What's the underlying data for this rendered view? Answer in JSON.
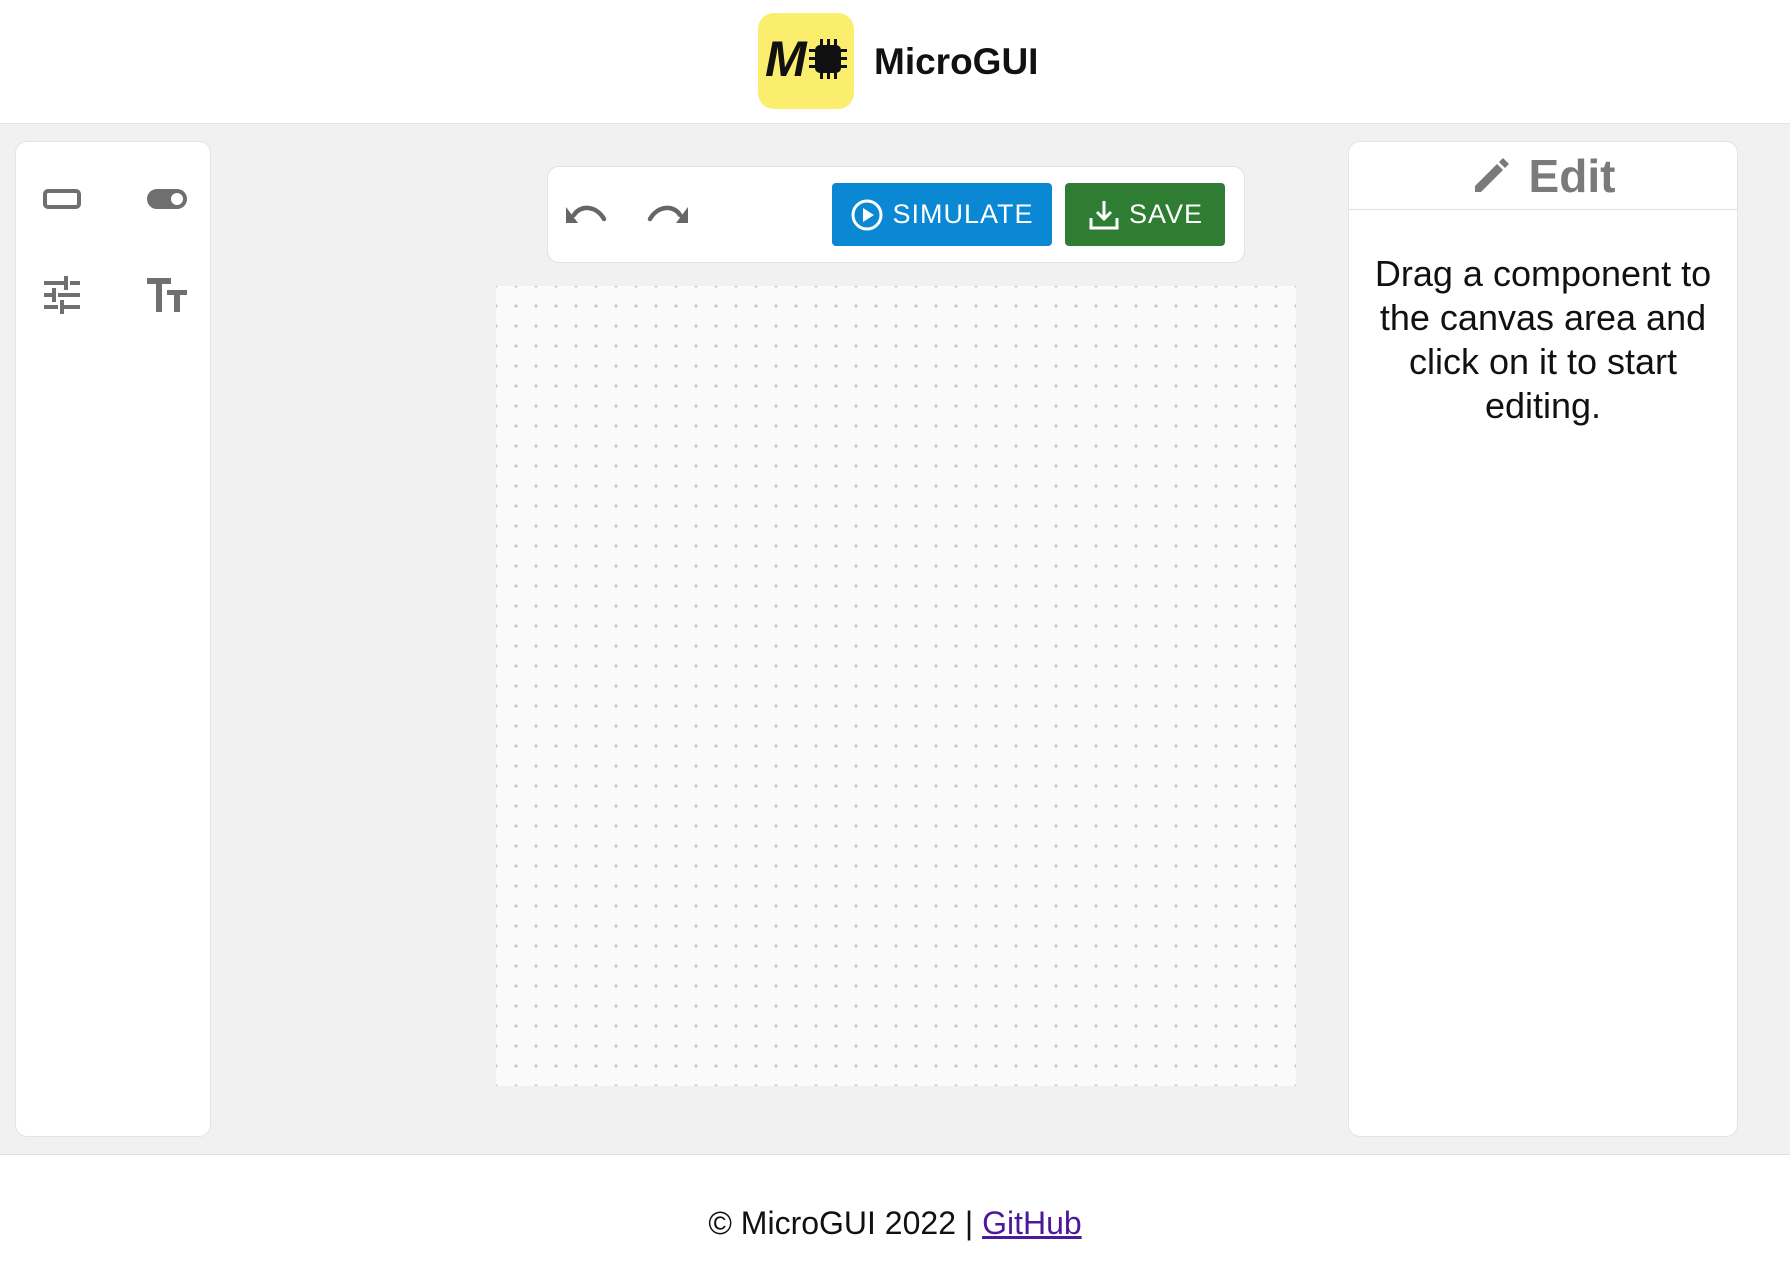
{
  "header": {
    "logo_text": "M",
    "title": "MicroGUI",
    "logo_color": "#fbee6e"
  },
  "palette": {
    "items": [
      {
        "name": "button-component",
        "icon": "rectangle-icon"
      },
      {
        "name": "switch-component",
        "icon": "toggle-icon"
      },
      {
        "name": "slider-component",
        "icon": "sliders-icon"
      },
      {
        "name": "text-component",
        "icon": "text-size-icon"
      }
    ]
  },
  "toolbar": {
    "undo_icon": "undo-icon",
    "redo_icon": "redo-icon",
    "simulate_label": "SIMULATE",
    "save_label": "SAVE",
    "simulate_color": "#0a88d4",
    "save_color": "#2e7d32"
  },
  "edit_panel": {
    "title": "Edit",
    "hint": "Drag a component to the canvas area and click on it to start editing."
  },
  "footer": {
    "copyright": "© MicroGUI 2022 | ",
    "link_label": "GitHub"
  }
}
